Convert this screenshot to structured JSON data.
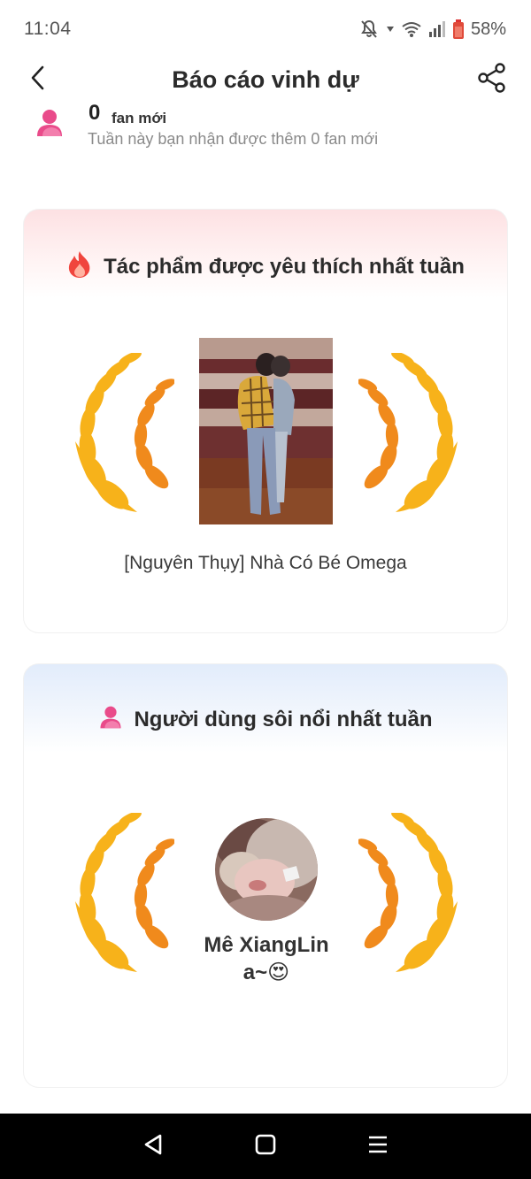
{
  "status_bar": {
    "time": "11:04",
    "battery": "58%",
    "icons": [
      "bell-off-icon",
      "wifi-icon",
      "signal-icon",
      "battery-icon"
    ]
  },
  "header": {
    "title": "Báo cáo vinh dự",
    "back_icon": "chevron-left-icon",
    "share_icon": "share-icon"
  },
  "fans": {
    "count": "0",
    "unit": "fan mới",
    "description": "Tuần này bạn nhận được thêm 0 fan mới",
    "icon": "user-icon"
  },
  "top_work": {
    "title": "Tác phẩm được yêu thích nhất tuần",
    "icon": "fire-icon",
    "work_name": "[Nguyên Thụy] Nhà Có Bé Omega"
  },
  "top_user": {
    "title": "Người dùng sôi nổi nhất tuần",
    "icon": "user-icon",
    "user_name_line1": "Mê XiangLin",
    "user_name_line2": "a~😍"
  },
  "colors": {
    "accent_pink": "#e94b8a",
    "laurel_gold": "#f7b21a",
    "laurel_orange": "#f08a1c",
    "work_card_top": "#fde1e3",
    "user_card_top": "#e2ecfb"
  },
  "nav_bar": {
    "icons": [
      "back-triangle-icon",
      "home-square-icon",
      "menu-icon"
    ]
  }
}
